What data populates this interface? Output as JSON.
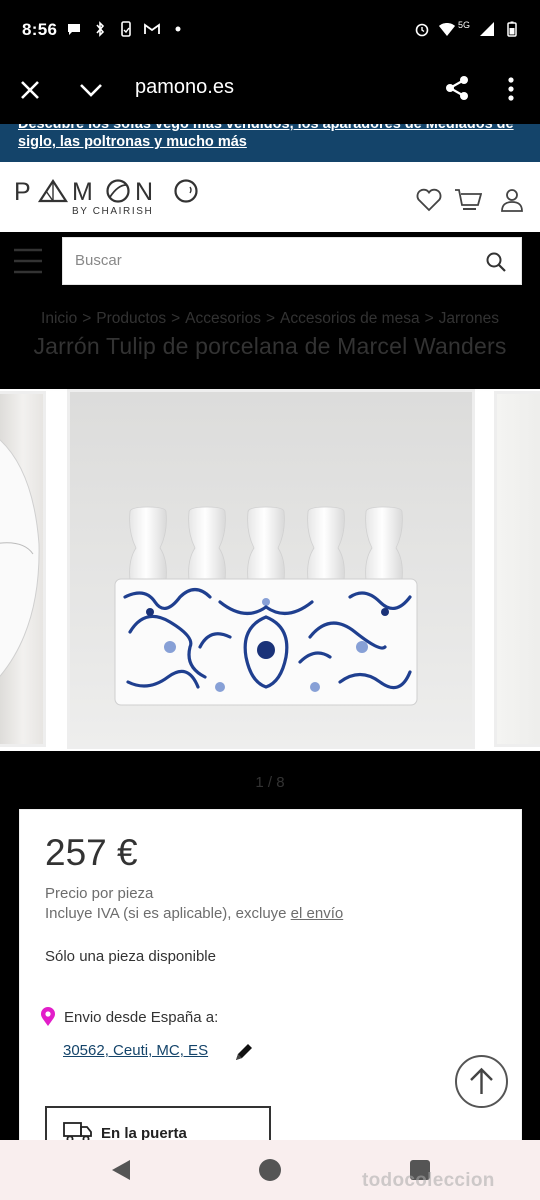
{
  "status_bar": {
    "time": "8:56",
    "network": "5G"
  },
  "browser": {
    "url": "pamono.es"
  },
  "promo": {
    "text": "Descubre los sofás vego más vendidos, los aparadores de Mediados de siglo, las poltronas y mucho más"
  },
  "header": {
    "logo_text": "PAMONO",
    "logo_sub": "BY CHAIRISH"
  },
  "search": {
    "placeholder": "Buscar"
  },
  "breadcrumb": [
    "Inicio",
    "Productos",
    "Accesorios",
    "Accesorios de mesa",
    "Jarrones"
  ],
  "breadcrumb_sep": ">",
  "product": {
    "title": "Jarrón Tulip de porcelana de Marcel Wanders",
    "pager": "1 / 8",
    "price": "257 €",
    "price_per": "Precio por pieza",
    "tax_note_prefix": "Incluye IVA (si es aplicable), excluye ",
    "shipping_link": "el envío",
    "availability": "Sólo una pieza disponible",
    "ship_from": "Envio desde España a:",
    "ship_location": "30562, Ceuti, MC, ES",
    "delivery_option": "En la puerta"
  },
  "watermark": "todocoleccion",
  "colors": {
    "brand_blue": "#14446a",
    "location_pin": "#e21ec9"
  }
}
